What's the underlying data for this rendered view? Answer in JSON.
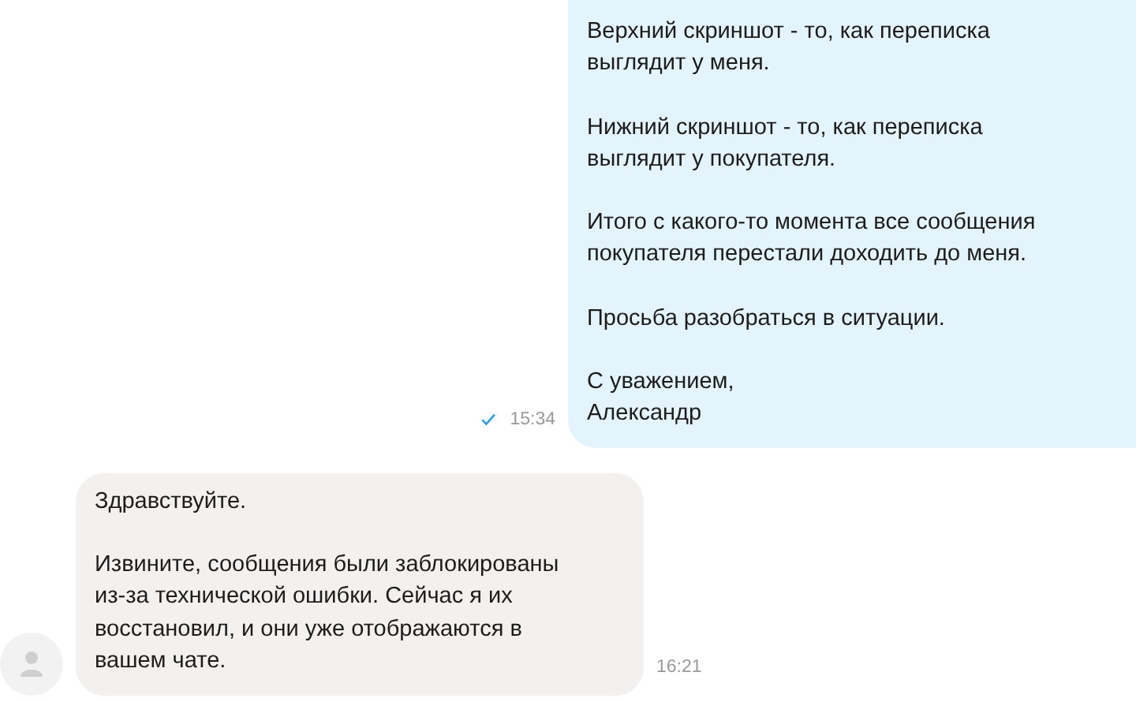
{
  "messages": [
    {
      "kind": "outgoing",
      "paragraphs": [
        [
          "Верхний скриншот - то, как переписка",
          "выглядит у меня."
        ],
        [
          "Нижний скриншот - то, как переписка",
          "выглядит у покупателя."
        ],
        [
          "Итого с какого-то момента все сообщения",
          "покупателя перестали доходить до меня."
        ],
        [
          "Просьба разобраться в ситуации."
        ],
        [
          "С уважением,",
          "Александр"
        ]
      ],
      "time": "15:34",
      "read": true
    },
    {
      "kind": "incoming",
      "paragraphs": [
        [
          "Здравствуйте."
        ],
        [
          "Извините, сообщения были заблокированы",
          "из-за технической ошибки. Сейчас я их",
          "восстановил, и они уже отображаются в",
          "вашем чате."
        ]
      ],
      "time": "16:21"
    }
  ]
}
